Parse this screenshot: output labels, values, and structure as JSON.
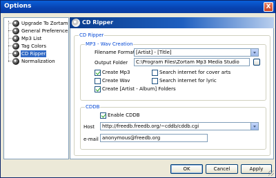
{
  "window": {
    "title": "Options",
    "close_label": "X"
  },
  "tree": {
    "items": [
      {
        "label": "Upgrade To Zortam I"
      },
      {
        "label": "General Preferences"
      },
      {
        "label": "Mp3 List"
      },
      {
        "label": "Tag Colors"
      },
      {
        "label": "CD Ripper",
        "selected": true
      },
      {
        "label": "Normalization"
      }
    ]
  },
  "panel": {
    "title": "CD Ripper"
  },
  "cd_ripper_group": {
    "label": "CD Ripper"
  },
  "mp3_wav_group": {
    "label": "MP3 - Wav Creation",
    "filename_format_label": "Filename Format",
    "filename_format_value": "[Artist] - [Title]",
    "output_folder_label": "Output Folder",
    "output_folder_value": "C:\\Program Files\\Zortam Mp3 Media Studio",
    "create_mp3": {
      "label": "Create Mp3",
      "checked": true
    },
    "create_wav": {
      "label": "Create Wav",
      "checked": false
    },
    "create_folders": {
      "label": "Create [Artist - Album] Folders",
      "checked": true
    },
    "search_cover": {
      "label": "Search internet for cover arts",
      "checked": false
    },
    "search_lyric": {
      "label": "Search internet for lyric",
      "checked": false
    }
  },
  "cddb_group": {
    "label": "CDDB",
    "enable": {
      "label": "Enable CDDB",
      "checked": true
    },
    "host_label": "Host",
    "host_value": "http://freedb.freedb.org/~cddb/cddb.cgi",
    "email_label": "e-mail",
    "email_value": "anonymous@freedb.org"
  },
  "buttons": {
    "ok": "OK",
    "cancel": "Cancel",
    "apply": "Apply"
  }
}
